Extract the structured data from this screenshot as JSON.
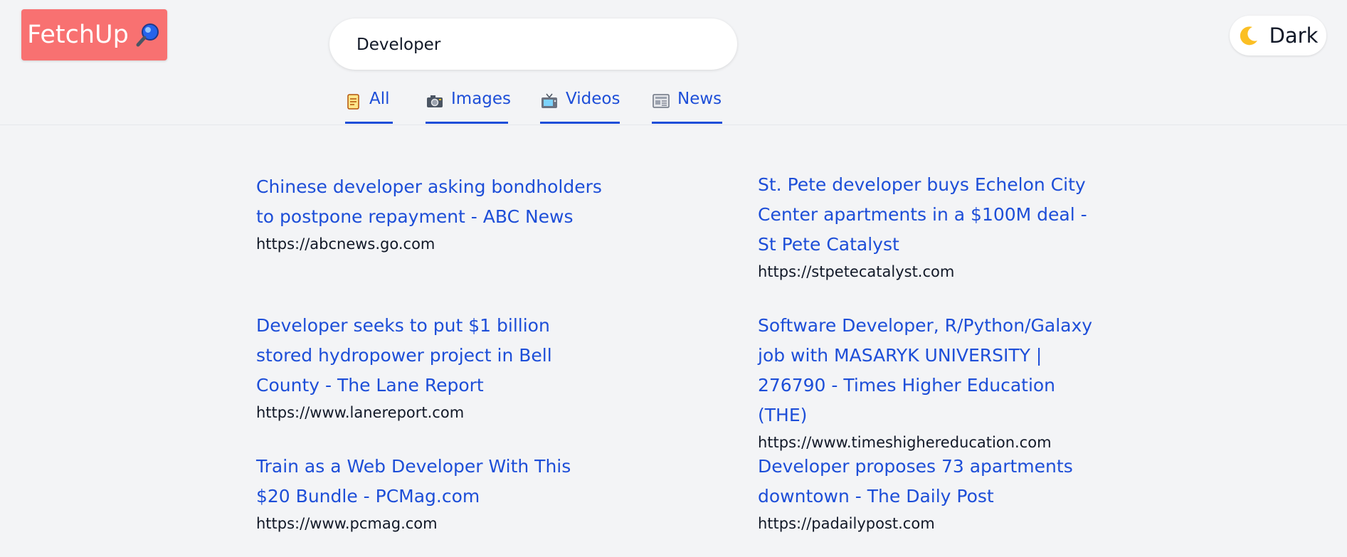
{
  "header": {
    "logo_text": "FetchUp",
    "logo_icon": "magnifying-glass-icon",
    "search_value": "Developer",
    "theme_toggle_label": "Dark",
    "theme_toggle_icon": "crescent-moon-icon"
  },
  "colors": {
    "logo_bg": "#f87171",
    "accent": "#1d4ed8",
    "page_bg": "#f3f4f6"
  },
  "tabs": [
    {
      "label": "All",
      "icon": "scroll-icon"
    },
    {
      "label": "Images",
      "icon": "camera-icon"
    },
    {
      "label": "Videos",
      "icon": "television-icon"
    },
    {
      "label": "News",
      "icon": "newspaper-icon"
    }
  ],
  "results": [
    {
      "title": "Chinese developer asking bondholders to postpone repayment - ABC News",
      "url": "https://abcnews.go.com"
    },
    {
      "title": "St. Pete developer buys Echelon City Center apartments in a $100M deal - St Pete Catalyst",
      "url": "https://stpetecatalyst.com"
    },
    {
      "title": "Developer seeks to put $1 billion stored hydropower project in Bell County - The Lane Report",
      "url": "https://www.lanereport.com"
    },
    {
      "title": "Software Developer, R/Python/Galaxy job with MASARYK UNIVERSITY | 276790 - Times Higher Education (THE)",
      "url": "https://www.timeshighereducation.com"
    },
    {
      "title": "Train as a Web Developer With This $20 Bundle - PCMag.com",
      "url": "https://www.pcmag.com"
    },
    {
      "title": "Developer proposes 73 apartments downtown - The Daily Post",
      "url": "https://padailypost.com"
    }
  ]
}
